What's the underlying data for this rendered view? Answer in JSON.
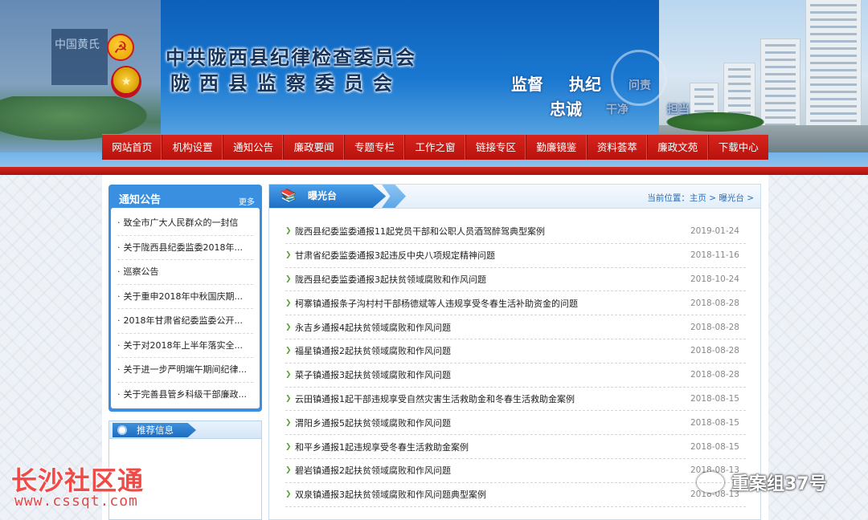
{
  "header": {
    "title_line1": "中共陇西县纪律检查委员会",
    "title_line2": "陇西县监察委员会",
    "slogans": [
      "监督",
      "执纪",
      "问责",
      "忠诚",
      "干净",
      "担当"
    ],
    "scene_sign_text": "中国黄氏"
  },
  "nav": {
    "items": [
      "网站首页",
      "机构设置",
      "通知公告",
      "廉政要闻",
      "专题专栏",
      "工作之窗",
      "链接专区",
      "勤廉镜鉴",
      "资料荟萃",
      "廉政文苑",
      "下载中心"
    ]
  },
  "sidebar": {
    "notice_title": "通知公告",
    "notice_more": "更多",
    "notices": [
      "致全市广大人民群众的一封信",
      "关于陇西县纪委监委2018年...",
      "巡察公告",
      "关于重申2018年中秋国庆期...",
      "2018年甘肃省纪委监委公开...",
      "关于对2018年上半年落实全...",
      "关于进一步严明端午期间纪律...",
      "关于完善县管乡科级干部廉政..."
    ],
    "recommend_title": "推荐信息"
  },
  "main": {
    "tab_title": "曝光台",
    "breadcrumb_prefix": "当前位置：",
    "breadcrumb_home": "主页",
    "breadcrumb_sep": " > ",
    "breadcrumb_current": "曝光台",
    "breadcrumb_end": " >",
    "news": [
      {
        "title": "陇西县纪委监委通报11起党员干部和公职人员酒驾醉驾典型案例",
        "date": "2019-01-24"
      },
      {
        "title": "甘肃省纪委监委通报3起违反中央八项规定精神问题",
        "date": "2018-11-16"
      },
      {
        "title": "陇西县纪委监委通报3起扶贫领域腐败和作风问题",
        "date": "2018-10-24"
      },
      {
        "title": "柯寨镇通报条子沟村村干部杨德斌等人违规享受冬春生活补助资金的问题",
        "date": "2018-08-28"
      },
      {
        "title": "永吉乡通报4起扶贫领域腐败和作风问题",
        "date": "2018-08-28"
      },
      {
        "title": "福星镇通报2起扶贫领域腐败和作风问题",
        "date": "2018-08-28"
      },
      {
        "title": "菜子镇通报3起扶贫领域腐败和作风问题",
        "date": "2018-08-28"
      },
      {
        "title": "云田镇通报1起干部违规享受自然灾害生活救助金和冬春生活救助金案例",
        "date": "2018-08-15"
      },
      {
        "title": "渭阳乡通报5起扶贫领域腐败和作风问题",
        "date": "2018-08-15"
      },
      {
        "title": "和平乡通报1起违规享受冬春生活救助金案例",
        "date": "2018-08-15"
      },
      {
        "title": "碧岩镇通报2起扶贫领域腐败和作风问题",
        "date": "2018-08-13"
      },
      {
        "title": "双泉镇通报3起扶贫领域腐败和作风问题典型案例",
        "date": "2018-08-13"
      }
    ]
  },
  "watermarks": {
    "left_text": "长沙社区通",
    "left_url": "www.cssqt.com",
    "right_text": "重案组37号"
  },
  "colors": {
    "nav_red": "#c81a14",
    "header_blue": "#1a78d0",
    "title_navy": "#16335c",
    "link_blue": "#2a6fb8",
    "bullet_green": "#5aa332"
  }
}
